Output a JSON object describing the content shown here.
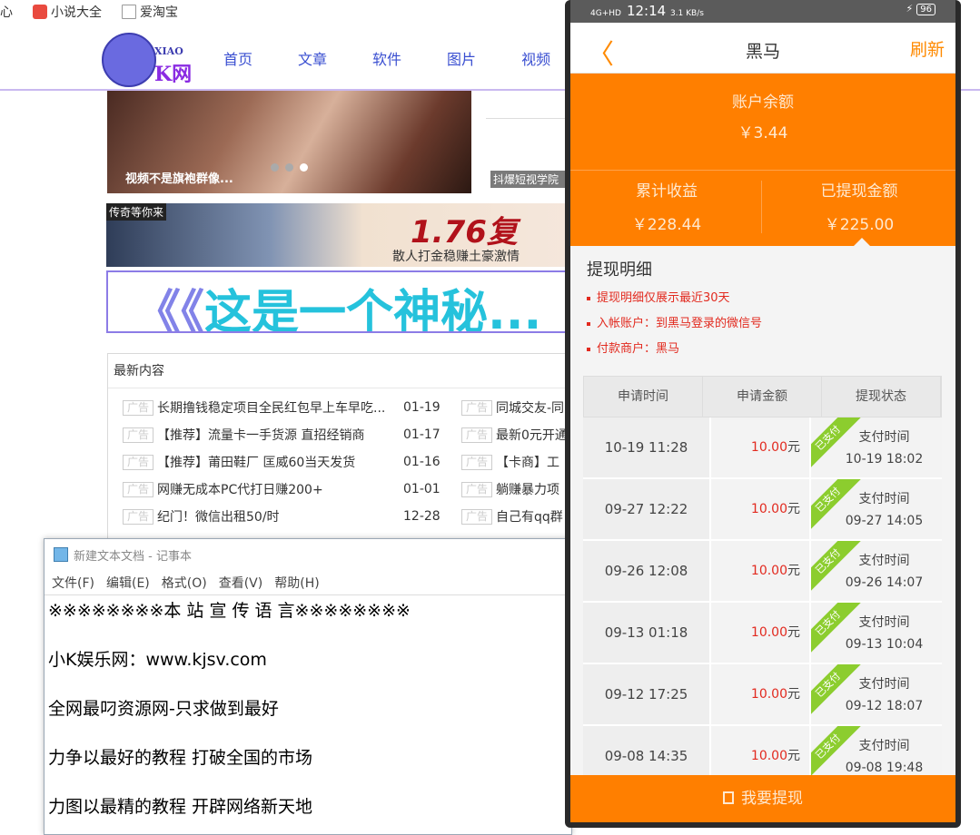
{
  "bookmarks": [
    {
      "label": "心"
    },
    {
      "label": "小说大全"
    },
    {
      "label": "爱淘宝"
    }
  ],
  "site": {
    "logo_small": "XIAO",
    "logo_big": "K网",
    "nav": [
      "首页",
      "文章",
      "软件",
      "图片",
      "视频"
    ],
    "slider_caption": "视频不是旗袍群像...",
    "slider2_caption": "抖爆短视学院",
    "ad1": {
      "tag": "传奇等你来",
      "big": "1.76复",
      "sub": "散人打金稳赚土豪激情"
    },
    "ad2": {
      "text_a": "《《",
      "text_b": "这是一个神秘..."
    },
    "latest_title": "最新内容",
    "ad_tag": "广告",
    "latest_left": [
      {
        "title": "长期撸钱稳定项目全民红包早上车早吃...",
        "date": "01-19"
      },
      {
        "title": "【推荐】流量卡一手货源 直招经销商",
        "date": "01-17"
      },
      {
        "title": "【推荐】莆田鞋厂 匡威60当天发货",
        "date": "01-16"
      },
      {
        "title": "网赚无成本PC代打日赚200+",
        "date": "01-01"
      },
      {
        "title": "纪门！微信出租50/时",
        "date": "12-28"
      }
    ],
    "latest_right": [
      {
        "title": "同城交友-同"
      },
      {
        "title": "最新0元开通"
      },
      {
        "title": "【卡商】工"
      },
      {
        "title": "躺赚暴力项"
      },
      {
        "title": "自己有qq群"
      }
    ]
  },
  "notepad": {
    "title": "新建文本文档 - 记事本",
    "menu": [
      "文件(F)",
      "编辑(E)",
      "格式(O)",
      "查看(V)",
      "帮助(H)"
    ],
    "lines": [
      "※※※※※※※※本 站 宣 传 语 言※※※※※※※※",
      "小K娱乐网：www.kjsv.com",
      "全网最叼资源网-只求做到最好",
      "力争以最好的教程 打破全国的市场",
      "力图以最精的教程 开辟网络新天地"
    ]
  },
  "phone": {
    "status_time": "12:14",
    "status_net": "4G+HD",
    "status_speed": "3.1 KB/s",
    "status_battery": "96",
    "title": "黑马",
    "back_glyph": "〈",
    "refresh": "刷新",
    "balance_label": "账户余额",
    "balance_value": "￥3.44",
    "earnings_label": "累计收益",
    "earnings_value": "￥228.44",
    "withdrawn_label": "已提现金额",
    "withdrawn_value": "￥225.00",
    "detail_title": "提现明细",
    "notes": [
      "提现明细仅展示最近30天",
      "入帐账户：到黑马登录的微信号",
      "付款商户：黑马"
    ],
    "table_headers": [
      "申请时间",
      "申请金额",
      "提现状态"
    ],
    "paid_tag": "已支付",
    "pay_time_label": "支付时间",
    "currency_unit": "元",
    "rows": [
      {
        "apply_time": "10-19 11:28",
        "amount": "10.00",
        "pay_time": "10-19 18:02"
      },
      {
        "apply_time": "09-27 12:22",
        "amount": "10.00",
        "pay_time": "09-27 14:05"
      },
      {
        "apply_time": "09-26 12:08",
        "amount": "10.00",
        "pay_time": "09-26 14:07"
      },
      {
        "apply_time": "09-13 01:18",
        "amount": "10.00",
        "pay_time": "09-13 10:04"
      },
      {
        "apply_time": "09-12 17:25",
        "amount": "10.00",
        "pay_time": "09-12 18:07"
      },
      {
        "apply_time": "09-08 14:35",
        "amount": "10.00",
        "pay_time": "09-08 19:48"
      }
    ],
    "withdraw_button": "我要提现"
  },
  "colors": {
    "accent_orange": "#ff7f00",
    "red": "#e22a1f",
    "paid_green": "#8ccd2e",
    "nav_blue": "#3a4fd1"
  }
}
